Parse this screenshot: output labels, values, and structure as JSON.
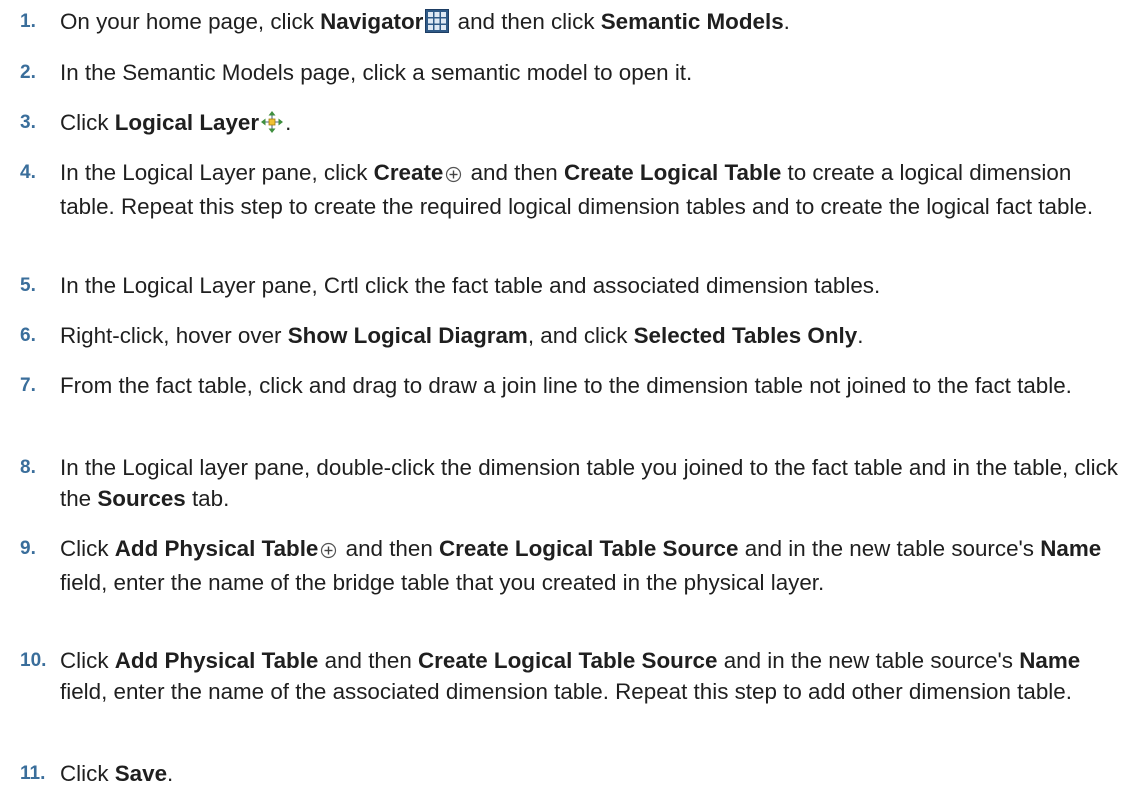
{
  "steps": [
    {
      "num": "1.",
      "parts": [
        {
          "t": "On your home page, click "
        },
        {
          "b": "Navigator"
        },
        {
          "icon": "navigator-grid-icon"
        },
        {
          "t": " and then click "
        },
        {
          "b": "Semantic Models"
        },
        {
          "t": "."
        }
      ]
    },
    {
      "num": "2.",
      "parts": [
        {
          "t": "In the Semantic Models page, click a semantic model to open it."
        }
      ]
    },
    {
      "num": "3.",
      "parts": [
        {
          "t": "Click "
        },
        {
          "b": "Logical Layer"
        },
        {
          "icon": "logical-layer-move-icon"
        },
        {
          "t": "."
        }
      ]
    },
    {
      "num": "4.",
      "parts": [
        {
          "t": "In the Logical Layer pane, click "
        },
        {
          "b": "Create"
        },
        {
          "icon": "create-plus-circle-icon"
        },
        {
          "t": " and then "
        },
        {
          "b": "Create Logical Table"
        },
        {
          "t": " to create a logical dimension table. Repeat this step to create the required logical dimension tables and to create the logical fact table."
        }
      ]
    },
    {
      "num": "5.",
      "parts": [
        {
          "t": "In the Logical Layer pane, Crtl click the fact table and associated dimension tables."
        }
      ]
    },
    {
      "num": "6.",
      "parts": [
        {
          "t": "Right-click, hover over "
        },
        {
          "b": "Show Logical Diagram"
        },
        {
          "t": ", and click "
        },
        {
          "b": "Selected Tables Only"
        },
        {
          "t": "."
        }
      ]
    },
    {
      "num": "7.",
      "parts": [
        {
          "t": "From the fact table, click and drag to draw a join line to the dimension table not joined to the fact table."
        }
      ]
    },
    {
      "num": "8.",
      "parts": [
        {
          "t": "In the Logical layer pane, double-click the dimension table you joined to the fact table and in the table, click the "
        },
        {
          "b": "Sources"
        },
        {
          "t": " tab."
        }
      ]
    },
    {
      "num": "9.",
      "parts": [
        {
          "t": "Click "
        },
        {
          "b": "Add Physical Table"
        },
        {
          "icon": "add-plus-circle-icon"
        },
        {
          "t": " and then "
        },
        {
          "b": "Create Logical Table Source"
        },
        {
          "t": " and in the new table source's "
        },
        {
          "b": "Name"
        },
        {
          "t": " field, enter the name of the bridge table that you created in the physical layer."
        }
      ]
    },
    {
      "num": "10.",
      "parts": [
        {
          "t": "Click "
        },
        {
          "b": "Add Physical Table"
        },
        {
          "t": " and then "
        },
        {
          "b": "Create Logical Table Source"
        },
        {
          "t": " and in the new table source's "
        },
        {
          "b": "Name"
        },
        {
          "t": " field, enter the name of the associated dimension table. Repeat this step to add other dimension table."
        }
      ]
    },
    {
      "num": "11.",
      "parts": [
        {
          "t": "Click "
        },
        {
          "b": "Save"
        },
        {
          "t": "."
        }
      ]
    }
  ]
}
